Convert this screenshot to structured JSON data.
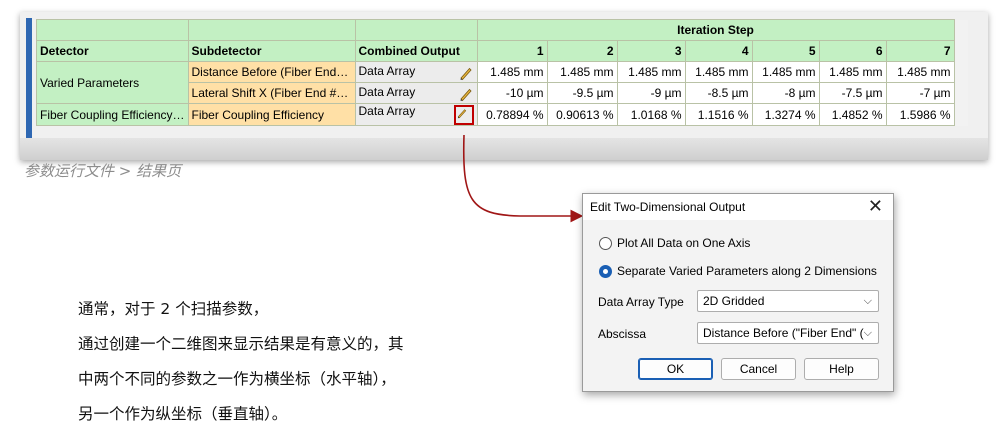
{
  "table": {
    "headers": {
      "detector": "Detector",
      "subdetector": "Subdetector",
      "combined_output": "Combined Output",
      "iteration_step": "Iteration Step",
      "steps": [
        "1",
        "2",
        "3",
        "4",
        "5",
        "6",
        "7"
      ]
    },
    "rows": [
      {
        "detector": "Varied Parameters",
        "subdetector": "Distance Before (Fiber End…",
        "combined": "Data Array",
        "values": [
          "1.485 mm",
          "1.485 mm",
          "1.485 mm",
          "1.485 mm",
          "1.485 mm",
          "1.485 mm",
          "1.485 mm"
        ]
      },
      {
        "detector": "",
        "subdetector": "Lateral Shift X (Fiber End #…",
        "combined": "Data Array",
        "values": [
          "-10 µm",
          "-9.5 µm",
          "-9 µm",
          "-8.5 µm",
          "-8 µm",
          "-7.5 µm",
          "-7 µm"
        ]
      },
      {
        "detector": "Fiber Coupling Efficiency…",
        "subdetector": "Fiber Coupling Efficiency",
        "combined": "Data Array",
        "values": [
          "0.78894 %",
          "0.90613 %",
          "1.0168 %",
          "1.1516 %",
          "1.3274 %",
          "1.4852 %",
          "1.5986 %"
        ]
      }
    ],
    "pencil_icon": "pencil-icon",
    "colors": {
      "header_green": "#c3f0c3",
      "sub_orange": "#ffe0a6",
      "highlight_red": "#c00000"
    }
  },
  "breadcrumb": "参数运行文件 > 结果页",
  "notes": {
    "lines": [
      "通常，对于 2 个扫描参数，",
      "通过创建一个二维图来显示结果是有意义的，其",
      "中两个不同的参数之一作为横坐标（水平轴），",
      "另一个作为纵坐标（垂直轴）。"
    ]
  },
  "dialog": {
    "title": "Edit Two-Dimensional Output",
    "close_icon": "close-icon",
    "options": [
      {
        "label": "Plot All Data on One Axis",
        "selected": false
      },
      {
        "label": "Separate Varied Parameters along 2 Dimensions",
        "selected": true
      }
    ],
    "data_array_type": {
      "label": "Data Array Type",
      "value": "2D Gridded"
    },
    "abscissa": {
      "label": "Abscissa",
      "value": "Distance Before (\"Fiber End\" ("
    },
    "buttons": {
      "ok": "OK",
      "cancel": "Cancel",
      "help": "Help"
    },
    "accent": "#1a5fb4"
  }
}
